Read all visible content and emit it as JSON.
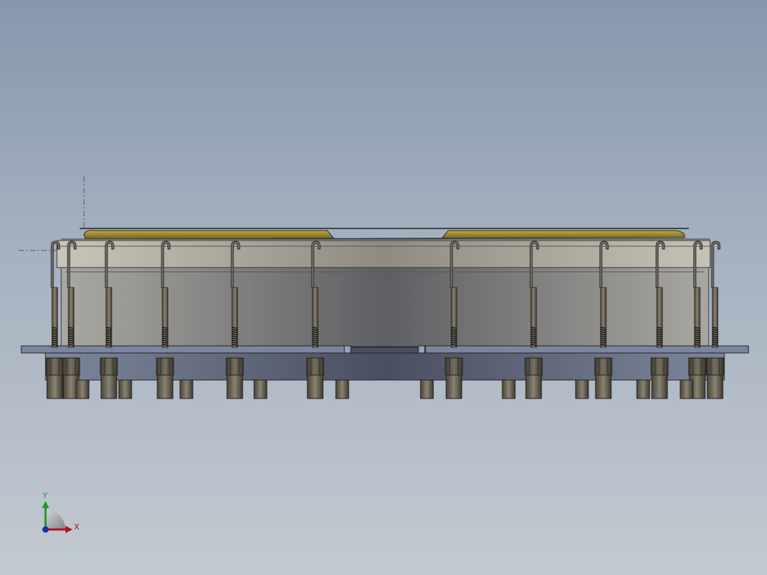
{
  "viewport": {
    "background_top": "#8697ad",
    "background_bottom": "#c3c9d0"
  },
  "model": {
    "shade_light": "#a5a39c",
    "shade_dark": "#4c4f5a",
    "cover_color": "#8a7a2e",
    "plate_color": "#6f7a90",
    "bolt_color": "#6a6254",
    "thread_color": "#1a1a1a",
    "hook_outline": "#2a2a2a"
  },
  "triad": {
    "x_label": "X",
    "y_label": "Y",
    "x_color": "#b0141c",
    "y_color": "#1f9a2a",
    "z_color": "#1d2fa8"
  }
}
